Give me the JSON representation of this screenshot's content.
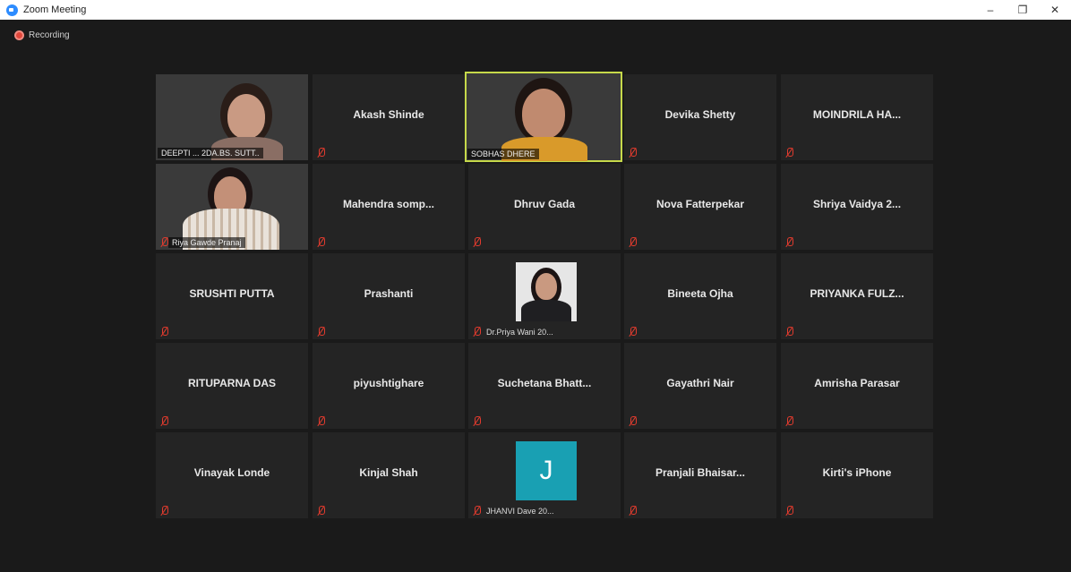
{
  "window": {
    "title": "Zoom Meeting",
    "controls": [
      "–",
      "❐",
      "✕"
    ]
  },
  "recording": {
    "label": "Recording"
  },
  "participants": [
    {
      "name": "DEEPTI ... 2DA.BS. SUTT..",
      "video": true
    },
    {
      "name": "Akash Shinde",
      "video": false
    },
    {
      "name": "SOBHAS DHERE",
      "video": true,
      "speaking": true
    },
    {
      "name": "Devika Shetty",
      "video": false
    },
    {
      "name": "MOINDRILA HA...",
      "video": false
    },
    {
      "name": "Riya Gawde Pranaj",
      "video": true
    },
    {
      "name": "Mahendra somp...",
      "video": false
    },
    {
      "name": "Dhruv Gada",
      "video": false
    },
    {
      "name": "Nova Fatterpekar",
      "video": false
    },
    {
      "name": "Shriya Vaidya 2...",
      "video": false
    },
    {
      "name": "SRUSHTI PUTTA",
      "video": false
    },
    {
      "name": "Prashanti",
      "video": false
    },
    {
      "name": "Dr.Priya Wani 20...",
      "photo": true
    },
    {
      "name": "Bineeta Ojha",
      "video": false
    },
    {
      "name": "PRIYANKA FULZ...",
      "video": false
    },
    {
      "name": "RITUPARNA DAS",
      "video": false
    },
    {
      "name": "piyushtighare",
      "video": false
    },
    {
      "name": "Suchetana Bhatt...",
      "video": false
    },
    {
      "name": "Gayathri Nair",
      "video": false
    },
    {
      "name": "Amrisha Parasar",
      "video": false
    },
    {
      "name": "Vinayak Londe",
      "video": false
    },
    {
      "name": "Kinjal Shah",
      "video": false
    },
    {
      "name": "JHANVI Dave 20...",
      "avatar": "J"
    },
    {
      "name": "Pranjali Bhaisar...",
      "video": false
    },
    {
      "name": "Kirti's iPhone",
      "video": false
    }
  ],
  "colors": {
    "tile_bg": "#242424",
    "speaker_outline": "#c6d94a",
    "mute_red": "#e23b2e",
    "avatar_teal": "#19a0b3"
  }
}
